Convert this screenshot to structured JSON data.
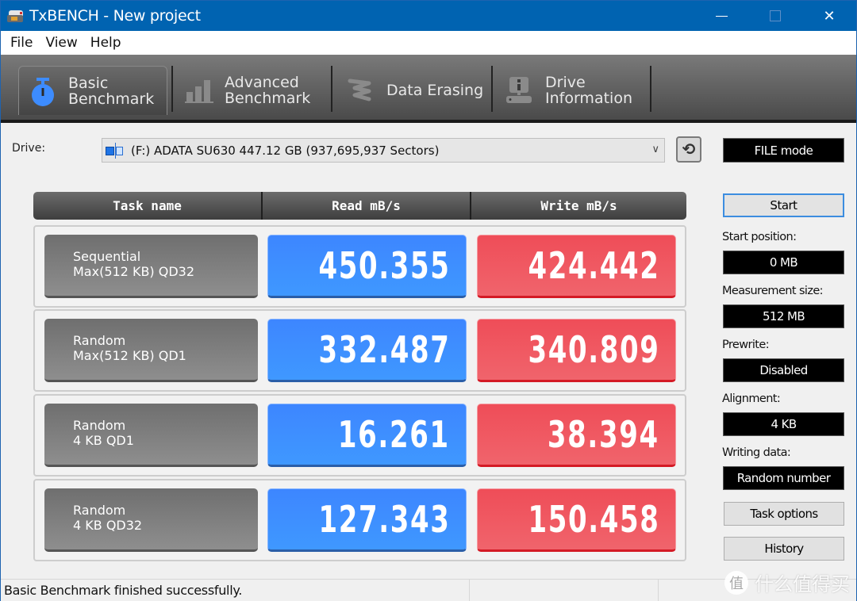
{
  "window": {
    "title": "TxBENCH - New project",
    "controls": {
      "minimize": "minimize",
      "maximize": "maximize",
      "close": "✕"
    }
  },
  "menu": [
    "File",
    "View",
    "Help"
  ],
  "toolbar": {
    "tabs": [
      {
        "label": "Basic\nBenchmark",
        "icon": "stopwatch-icon",
        "active": true
      },
      {
        "label": "Advanced\nBenchmark",
        "icon": "bar-chart-icon",
        "active": false
      },
      {
        "label": "Data Erasing",
        "icon": "eraser-icon",
        "active": false
      },
      {
        "label": "Drive\nInformation",
        "icon": "drive-info-icon",
        "active": false
      }
    ]
  },
  "drive": {
    "label": "Drive:",
    "selected": "(F:) ADATA SU630  447.12 GB (937,695,937 Sectors)",
    "mode": "FILE mode"
  },
  "table": {
    "headers": [
      "Task name",
      "Read mB/s",
      "Write mB/s"
    ],
    "rows": [
      {
        "task": "Sequential\nMax(512 KB) QD32",
        "read": "450.355",
        "write": "424.442"
      },
      {
        "task": "Random\nMax(512 KB) QD1",
        "read": "332.487",
        "write": "340.809"
      },
      {
        "task": "Random\n4 KB QD1",
        "read": "16.261",
        "write": "38.394"
      },
      {
        "task": "Random\n4 KB QD32",
        "read": "127.343",
        "write": "150.458"
      }
    ]
  },
  "side": {
    "start_label": "Start",
    "params": [
      {
        "label": "Start position:",
        "value": "0 MB"
      },
      {
        "label": "Measurement size:",
        "value": "512 MB"
      },
      {
        "label": "Prewrite:",
        "value": "Disabled"
      },
      {
        "label": "Alignment:",
        "value": "4 KB"
      },
      {
        "label": "Writing data:",
        "value": "Random number"
      }
    ],
    "task_options_label": "Task options",
    "history_label": "History"
  },
  "status": {
    "message": "Basic Benchmark finished successfully."
  },
  "watermark": {
    "badge": "值",
    "text": "什么值得买"
  },
  "colors": {
    "titlebar": "#0063b1",
    "read": "#3f8fff",
    "write": "#ef5860"
  }
}
